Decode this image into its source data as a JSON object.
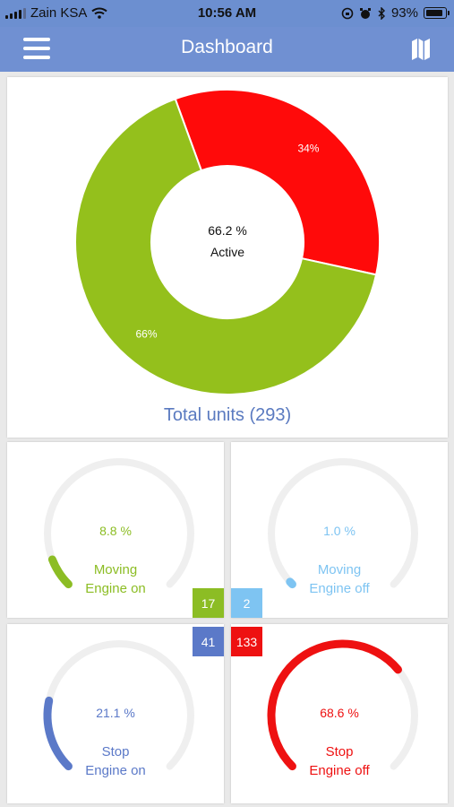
{
  "status_bar": {
    "carrier": "Zain KSA",
    "time": "10:56 AM",
    "battery": "93%"
  },
  "header": {
    "title": "Dashboard",
    "menu_icon": "hamburger-menu-icon",
    "map_icon": "map-icon"
  },
  "summary": {
    "center_percent": "66.2 %",
    "center_label": "Active",
    "total_units": "Total units (293)"
  },
  "chart_data": {
    "type": "pie",
    "donut": true,
    "slices": [
      {
        "label": "34%",
        "value": 34,
        "color": "#ff0a0a"
      },
      {
        "label": "66%",
        "value": 66,
        "color": "#94c01c"
      }
    ]
  },
  "gauges": [
    {
      "percent": "8.8 %",
      "value": 8.8,
      "line1": "Moving",
      "line2": "Engine on",
      "color": "#8cbd24"
    },
    {
      "percent": "1.0 %",
      "value": 1.0,
      "line1": "Moving",
      "line2": "Engine off",
      "color": "#7ec4f2"
    },
    {
      "percent": "21.1 %",
      "value": 21.1,
      "line1": "Stop",
      "line2": "Engine on",
      "color": "#5b79c8"
    },
    {
      "percent": "68.6 %",
      "value": 68.6,
      "line1": "Stop",
      "line2": "Engine off",
      "color": "#ee1111"
    }
  ],
  "badges": [
    {
      "value": "17",
      "color": "#8cbd24"
    },
    {
      "value": "2",
      "color": "#7ec4f2"
    },
    {
      "value": "41",
      "color": "#5b79c8"
    },
    {
      "value": "133",
      "color": "#ee1111"
    }
  ]
}
